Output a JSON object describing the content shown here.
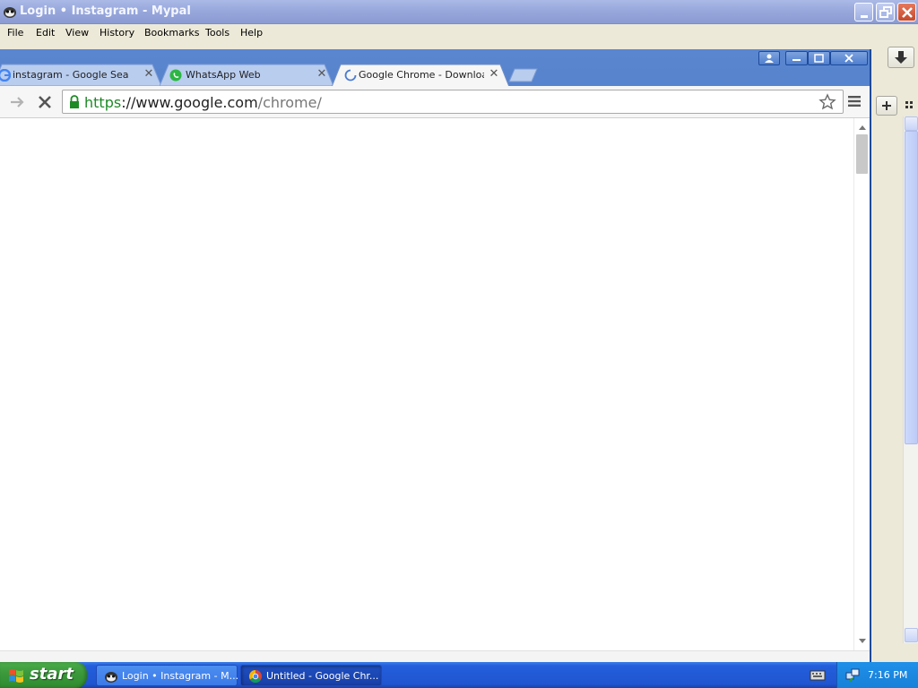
{
  "mypal": {
    "title": "Login • Instagram - Mypal",
    "menu": [
      "File",
      "Edit",
      "View",
      "History",
      "Bookmarks",
      "Tools",
      "Help"
    ]
  },
  "chrome": {
    "tabs": [
      {
        "label": "instagram - Google Search",
        "favicon": "google-icon",
        "active": false
      },
      {
        "label": "WhatsApp Web",
        "favicon": "whatsapp-icon",
        "active": false
      },
      {
        "label": "Google Chrome - Download t",
        "favicon": "loading-spinner-icon",
        "active": true
      }
    ],
    "url": {
      "scheme": "https",
      "separator": "://",
      "host": "www.google.com",
      "path": "/chrome/"
    }
  },
  "taskbar": {
    "start_label": "start",
    "tasks": [
      {
        "label": "Login • Instagram - M...",
        "icon": "mypal-icon"
      },
      {
        "label": "Untitled - Google Chr...",
        "icon": "chrome-icon"
      }
    ],
    "clock": "7:16 PM"
  },
  "colors": {
    "xp_blue": "#245edb",
    "start_green": "#3c9a3c",
    "secure_green": "#1d8a26"
  }
}
